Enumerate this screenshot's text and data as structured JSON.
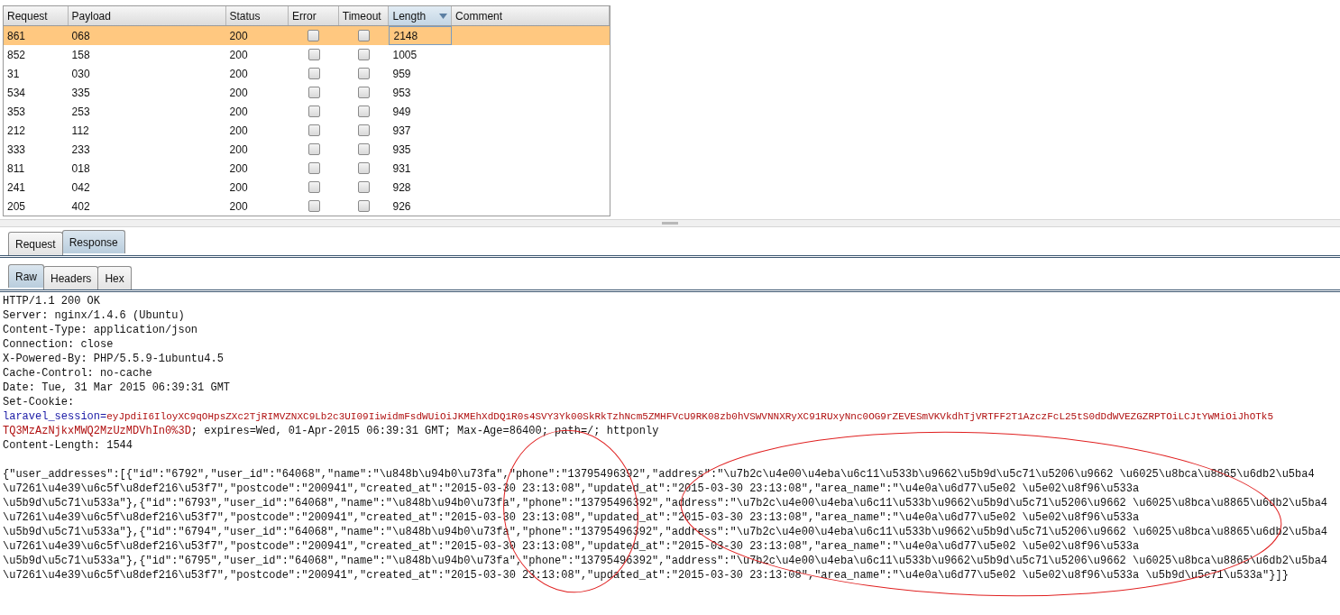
{
  "results_table": {
    "columns": [
      {
        "label": "Request",
        "sorted": false
      },
      {
        "label": "Payload",
        "sorted": false
      },
      {
        "label": "Status",
        "sorted": false
      },
      {
        "label": "Error",
        "sorted": false
      },
      {
        "label": "Timeout",
        "sorted": false
      },
      {
        "label": "Length",
        "sorted": true
      },
      {
        "label": "Comment",
        "sorted": false
      }
    ],
    "rows": [
      {
        "request": "861",
        "payload": "068",
        "status": "200",
        "error": false,
        "timeout": false,
        "length": "2148",
        "selected": true
      },
      {
        "request": "852",
        "payload": "158",
        "status": "200",
        "error": false,
        "timeout": false,
        "length": "1005",
        "selected": false
      },
      {
        "request": "31",
        "payload": "030",
        "status": "200",
        "error": false,
        "timeout": false,
        "length": "959",
        "selected": false
      },
      {
        "request": "534",
        "payload": "335",
        "status": "200",
        "error": false,
        "timeout": false,
        "length": "953",
        "selected": false
      },
      {
        "request": "353",
        "payload": "253",
        "status": "200",
        "error": false,
        "timeout": false,
        "length": "949",
        "selected": false
      },
      {
        "request": "212",
        "payload": "112",
        "status": "200",
        "error": false,
        "timeout": false,
        "length": "937",
        "selected": false
      },
      {
        "request": "333",
        "payload": "233",
        "status": "200",
        "error": false,
        "timeout": false,
        "length": "935",
        "selected": false
      },
      {
        "request": "811",
        "payload": "018",
        "status": "200",
        "error": false,
        "timeout": false,
        "length": "931",
        "selected": false
      },
      {
        "request": "241",
        "payload": "042",
        "status": "200",
        "error": false,
        "timeout": false,
        "length": "928",
        "selected": false
      },
      {
        "request": "205",
        "payload": "402",
        "status": "200",
        "error": false,
        "timeout": false,
        "length": "926",
        "selected": false
      }
    ]
  },
  "message_tabs": [
    {
      "label": "Request",
      "selected": false
    },
    {
      "label": "Response",
      "selected": true
    }
  ],
  "view_tabs": [
    {
      "label": "Raw",
      "selected": true
    },
    {
      "label": "Headers",
      "selected": false
    },
    {
      "label": "Hex",
      "selected": false
    }
  ],
  "response": {
    "headers": [
      "HTTP/1.1 200 OK",
      "Server: nginx/1.4.6 (Ubuntu)",
      "Content-Type: application/json",
      "Connection: close",
      "X-Powered-By: PHP/5.5.9-1ubuntu4.5",
      "Cache-Control: no-cache",
      "Date: Tue, 31 Mar 2015 06:39:31 GMT",
      "Set-Cookie:"
    ],
    "cookie_name": "laravel_session=",
    "cookie_value_line_1": "eyJpdiI6IloyXC9qOHpsZXc2TjRIMVZNXC9Lb2c3UI09IiwidmFsdWUiOiJKMEhXdDQ1R0s4SVY3Yk00SkRkTzhNcm5ZMHFVcU9RK08zb0hVSWVNNXRyXC91RUxyNnc0OG9rZEVESmVKVkdhTjVRTFF2T1AzczFcL25tS0dDdWVEZGZRPTOiLCJtYWMiOiJhOTk5",
    "cookie_value_line_2": "TQ3MzAzNjkxMWQ2MzUzMDVhIn0%3D",
    "cookie_attributes": "; expires=Wed, 01-Apr-2015 06:39:31 GMT; Max-Age=86400; path=/; httponly",
    "content_length": "Content-Length: 1544",
    "body_lines": [
      "{\"user_addresses\":[{\"id\":\"6792\",\"user_id\":\"64068\",\"name\":\"\\u848b\\u94b0\\u73fa\",\"phone\":\"13795496392\",\"address\":\"\\u7b2c\\u4e00\\u4eba\\u6c11\\u533b\\u9662\\u5b9d\\u5c71\\u5206\\u9662 \\u6025\\u8bca\\u8865\\u6db2\\u5ba4",
      "\\u7261\\u4e39\\u6c5f\\u8def216\\u53f7\",\"postcode\":\"200941\",\"created_at\":\"2015-03-30 23:13:08\",\"updated_at\":\"2015-03-30 23:13:08\",\"area_name\":\"\\u4e0a\\u6d77\\u5e02 \\u5e02\\u8f96\\u533a",
      "\\u5b9d\\u5c71\\u533a\"},{\"id\":\"6793\",\"user_id\":\"64068\",\"name\":\"\\u848b\\u94b0\\u73fa\",\"phone\":\"13795496392\",\"address\":\"\\u7b2c\\u4e00\\u4eba\\u6c11\\u533b\\u9662\\u5b9d\\u5c71\\u5206\\u9662 \\u6025\\u8bca\\u8865\\u6db2\\u5ba4",
      "\\u7261\\u4e39\\u6c5f\\u8def216\\u53f7\",\"postcode\":\"200941\",\"created_at\":\"2015-03-30 23:13:08\",\"updated_at\":\"2015-03-30 23:13:08\",\"area_name\":\"\\u4e0a\\u6d77\\u5e02 \\u5e02\\u8f96\\u533a",
      "\\u5b9d\\u5c71\\u533a\"},{\"id\":\"6794\",\"user_id\":\"64068\",\"name\":\"\\u848b\\u94b0\\u73fa\",\"phone\":\"13795496392\",\"address\":\"\\u7b2c\\u4e00\\u4eba\\u6c11\\u533b\\u9662\\u5b9d\\u5c71\\u5206\\u9662 \\u6025\\u8bca\\u8865\\u6db2\\u5ba4",
      "\\u7261\\u4e39\\u6c5f\\u8def216\\u53f7\",\"postcode\":\"200941\",\"created_at\":\"2015-03-30 23:13:08\",\"updated_at\":\"2015-03-30 23:13:08\",\"area_name\":\"\\u4e0a\\u6d77\\u5e02 \\u5e02\\u8f96\\u533a",
      "\\u5b9d\\u5c71\\u533a\"},{\"id\":\"6795\",\"user_id\":\"64068\",\"name\":\"\\u848b\\u94b0\\u73fa\",\"phone\":\"13795496392\",\"address\":\"\\u7b2c\\u4e00\\u4eba\\u6c11\\u533b\\u9662\\u5b9d\\u5c71\\u5206\\u9662 \\u6025\\u8bca\\u8865\\u6db2\\u5ba4",
      "\\u7261\\u4e39\\u6c5f\\u8def216\\u53f7\",\"postcode\":\"200941\",\"created_at\":\"2015-03-30 23:13:08\",\"updated_at\":\"2015-03-30 23:13:08\",\"area_name\":\"\\u4e0a\\u6d77\\u5e02 \\u5e02\\u8f96\\u533a \\u5b9d\\u5c71\\u533a\"}]}"
    ]
  }
}
